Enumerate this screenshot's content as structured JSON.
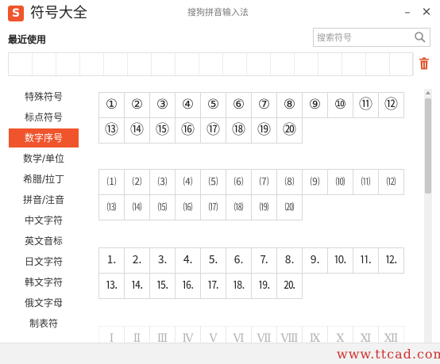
{
  "app": {
    "logo_glyph": "S",
    "title": "符号大全",
    "subtitle": "搜狗拼音输入法",
    "minimize_glyph": "–",
    "close_glyph": "✕"
  },
  "recent": {
    "label": "最近使用",
    "slots": 17
  },
  "search": {
    "placeholder": "搜索符号",
    "value": ""
  },
  "sidebar": {
    "active_index": 2,
    "items": [
      {
        "label": "特殊符号"
      },
      {
        "label": "标点符号"
      },
      {
        "label": "数字序号"
      },
      {
        "label": "数学/单位"
      },
      {
        "label": "希腊/拉丁"
      },
      {
        "label": "拼音/注音"
      },
      {
        "label": "中文字符"
      },
      {
        "label": "英文音标"
      },
      {
        "label": "日文字符"
      },
      {
        "label": "韩文字符"
      },
      {
        "label": "俄文字母"
      },
      {
        "label": "制表符"
      }
    ]
  },
  "groups": {
    "circled": {
      "row1": [
        "①",
        "②",
        "③",
        "④",
        "⑤",
        "⑥",
        "⑦",
        "⑧",
        "⑨",
        "⑩",
        "⑪",
        "⑫"
      ],
      "row2": [
        "⑬",
        "⑭",
        "⑮",
        "⑯",
        "⑰",
        "⑱",
        "⑲",
        "⑳"
      ]
    },
    "parenthesized": {
      "row1": [
        "⑴",
        "⑵",
        "⑶",
        "⑷",
        "⑸",
        "⑹",
        "⑺",
        "⑻",
        "⑼",
        "⑽",
        "⑾",
        "⑿"
      ],
      "row2": [
        "⒀",
        "⒁",
        "⒂",
        "⒃",
        "⒄",
        "⒅",
        "⒆",
        "⒇"
      ]
    },
    "full_stop": {
      "row1": [
        "⒈",
        "⒉",
        "⒊",
        "⒋",
        "⒌",
        "⒍",
        "⒎",
        "⒏",
        "⒐",
        "⒑",
        "⒒",
        "⒓"
      ],
      "row2": [
        "⒔",
        "⒕",
        "⒖",
        "⒗",
        "⒘",
        "⒙",
        "⒚",
        "⒛"
      ]
    },
    "roman_partial": {
      "row1": [
        "Ⅰ",
        "Ⅱ",
        "Ⅲ",
        "Ⅳ",
        "Ⅴ",
        "Ⅵ",
        "Ⅶ",
        "Ⅷ",
        "Ⅸ",
        "Ⅹ",
        "Ⅺ",
        "Ⅻ"
      ]
    }
  },
  "watermark": "www.ttcad.com",
  "colors": {
    "accent": "#f0542c",
    "watermark": "#d03030"
  },
  "icons": [
    "sogou-logo-icon",
    "minimize-icon",
    "close-icon",
    "search-icon",
    "trash-icon",
    "scroll-up-icon"
  ]
}
